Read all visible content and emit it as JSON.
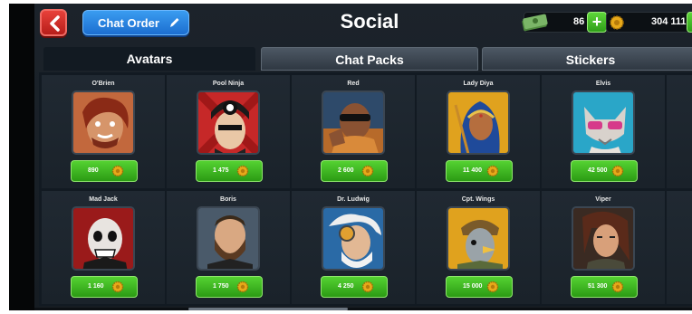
{
  "header": {
    "back_icon": "chevron-left-icon",
    "chat_order_label": "Chat Order",
    "title": "Social",
    "cash_amount": "86",
    "coin_amount": "304 111"
  },
  "tabs": [
    {
      "label": "Avatars",
      "active": true
    },
    {
      "label": "Chat Packs",
      "active": false
    },
    {
      "label": "Stickers",
      "active": false
    }
  ],
  "avatars": [
    {
      "name": "O'Brien",
      "price": "890"
    },
    {
      "name": "Pool Ninja",
      "price": "1 475"
    },
    {
      "name": "Red",
      "price": "2 600"
    },
    {
      "name": "Lady Diya",
      "price": "11 400"
    },
    {
      "name": "Elvis",
      "price": "42 500"
    },
    {
      "name": "Mad Jack",
      "price": "1 160"
    },
    {
      "name": "Boris",
      "price": "1 750"
    },
    {
      "name": "Dr. Ludwig",
      "price": "4 250"
    },
    {
      "name": "Cpt. Wings",
      "price": "15 000"
    },
    {
      "name": "Viper",
      "price": "51 300"
    }
  ],
  "colors": {
    "background": "#161c22",
    "price_button": "#3bb51f",
    "back_button": "#d7302b",
    "chat_order_button": "#2a86e2",
    "coin": "#e8a91a"
  }
}
